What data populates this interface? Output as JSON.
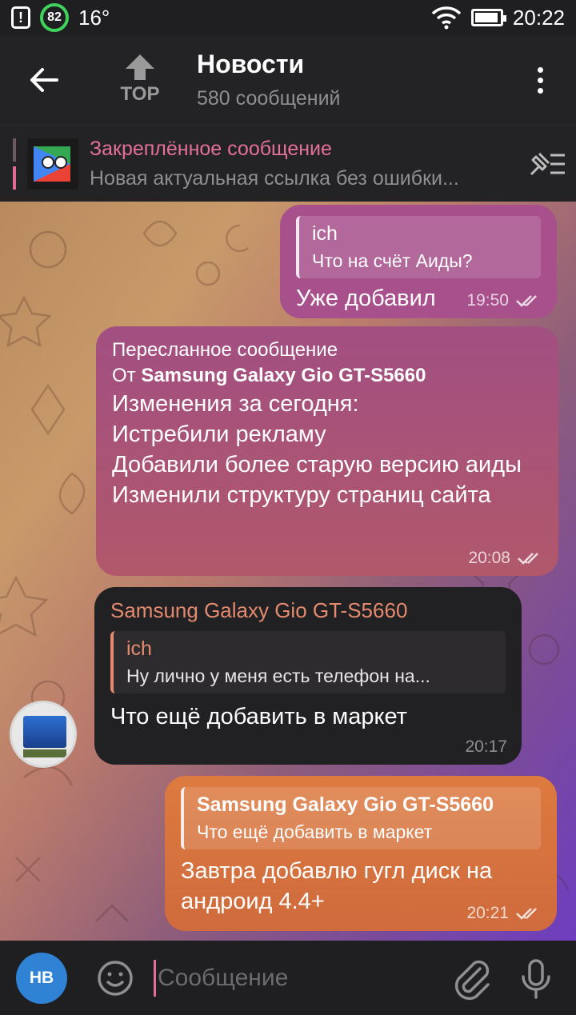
{
  "status_bar": {
    "warning_glyph": "!",
    "badge_number": "82",
    "temperature": "16°",
    "time": "20:22",
    "icons": [
      "warning-icon",
      "notification-circle-icon",
      "wifi-icon",
      "battery-icon"
    ]
  },
  "header": {
    "back_icon": "arrow-left-icon",
    "logo_text": "TOP",
    "title": "Новости",
    "subtitle": "580 сообщений",
    "menu_icon": "more-vertical-icon"
  },
  "pinned": {
    "title": "Закреплённое сообщение",
    "text": "Новая актуальная ссылка без ошибки...",
    "icon": "unpin-list-icon",
    "accent": "#e46f9b"
  },
  "messages": [
    {
      "reply_name": "ich",
      "reply_text": "Что на счёт Аиды?",
      "text": "Уже добавил",
      "time": "19:50",
      "status_icon": "double-check-icon"
    },
    {
      "forward_label": "Пересланное сообщение",
      "forward_prefix": "От ",
      "forward_from": "Samsung Galaxy Gio GT-S5660",
      "lines": [
        "Изменения за сегодня:",
        "Истребили рекламу",
        "Добавили более старую версию аиды",
        "Изменили структуру страниц сайта"
      ],
      "time": "20:08",
      "status_icon": "double-check-icon"
    },
    {
      "sender": "Samsung Galaxy Gio GT-S5660",
      "reply_name": "ich",
      "reply_text": "Ну лично у меня есть телефон на...",
      "text": "Что ещё добавить в маркет",
      "time": "20:17"
    },
    {
      "reply_name": "Samsung Galaxy Gio GT-S5660",
      "reply_text": "Что ещё добавить в маркет",
      "text": "Завтра добавлю гугл диск на андроид 4.4+",
      "time": "20:21",
      "status_icon": "double-check-icon"
    }
  ],
  "input": {
    "avatar_initials": "НВ",
    "placeholder": "Сообщение",
    "icons": [
      "emoji-icon",
      "attach-icon",
      "mic-icon"
    ]
  },
  "colors": {
    "outgoing_pink": "#a7508c",
    "outgoing_orange": "#dd7a3f",
    "incoming_dark": "#212023",
    "sender_name": "#e48a6e",
    "avatar_blue": "#2f82d4"
  }
}
